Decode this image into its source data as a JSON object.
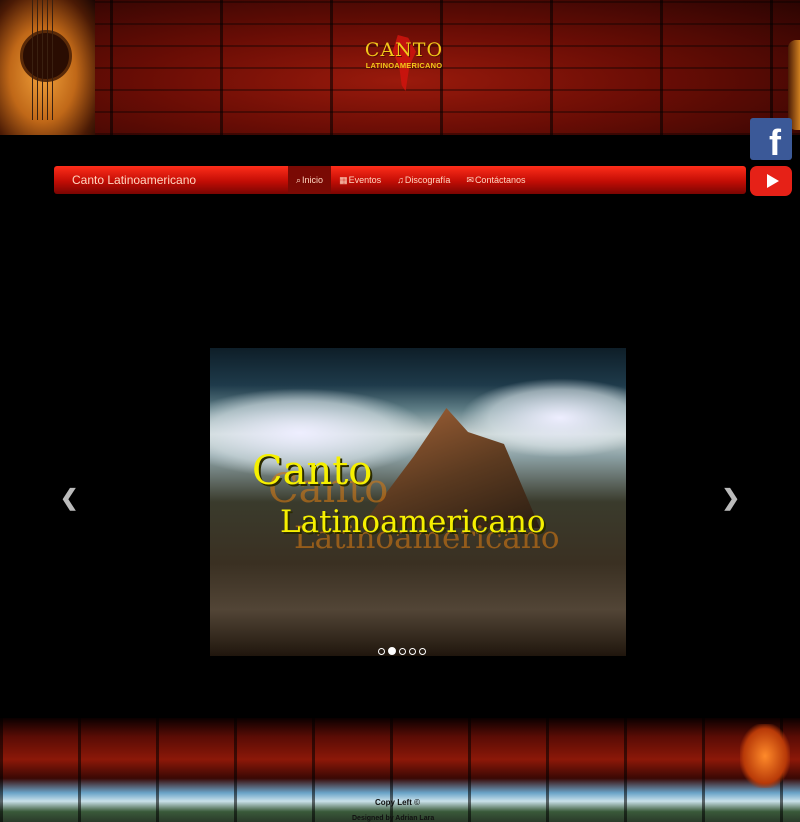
{
  "header": {
    "logo_line1": "CANTO",
    "logo_line2": "LATINOAMERICANO"
  },
  "social": {
    "facebook_icon": "facebook-icon",
    "youtube_icon": "youtube-icon"
  },
  "navbar": {
    "brand": "Canto Latinoamericano",
    "items": [
      {
        "icon": "search-icon",
        "glyph": "⌕",
        "label": "Inicio",
        "active": true
      },
      {
        "icon": "calendar-icon",
        "glyph": "▦",
        "label": "Eventos",
        "active": false
      },
      {
        "icon": "music-icon",
        "glyph": "♫",
        "label": "Discografía",
        "active": false
      },
      {
        "icon": "envelope-icon",
        "glyph": "✉",
        "label": "Contáctanos",
        "active": false
      }
    ]
  },
  "carousel": {
    "slide_line1": "Canto",
    "slide_line2": "Latinoamericano",
    "prev_glyph": "❮",
    "next_glyph": "❯",
    "slide_count": 5,
    "active_index": 1
  },
  "footer": {
    "copy": "Copy Left ©",
    "designed_by": "Designed by Adrian Lara"
  },
  "colors": {
    "navbar_top": "#ff2d1a",
    "navbar_bottom": "#7a0502",
    "logo_yellow": "#f2c81a",
    "slide_text": "#f6f000"
  }
}
